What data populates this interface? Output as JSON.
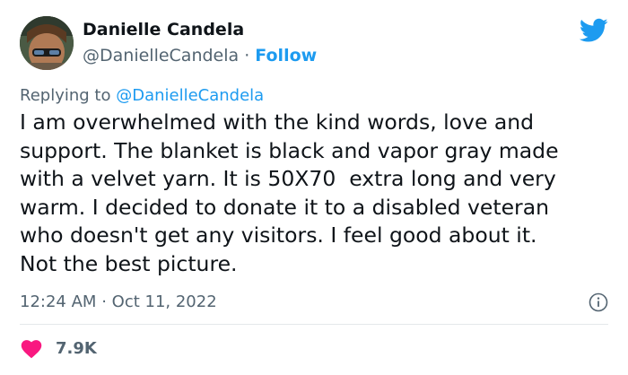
{
  "tweet": {
    "display_name": "Danielle Candela",
    "handle": "@DanielleCandela",
    "separator": "·",
    "follow_label": "Follow",
    "reply_prefix": "Replying to",
    "reply_handle": "@DanielleCandela",
    "text": "I am overwhelmed with the kind words, love and\nsupport. The blanket is black and vapor gray made\nwith a velvet yarn. It is 50X70  extra long and very\nwarm. I decided to donate it to a disabled veteran\nwho doesn't get any visitors. I feel good about it.\nNot the best picture.",
    "time": "12:24 AM",
    "date": "Oct 11, 2022",
    "like_count": "7.9K"
  },
  "icons": {
    "brand": "twitter-bird-icon",
    "info": "info-icon",
    "like": "heart-icon"
  },
  "colors": {
    "accent": "#1d9bf0",
    "like": "#f91880",
    "secondary_text": "#536471",
    "primary_text": "#0f1419"
  }
}
